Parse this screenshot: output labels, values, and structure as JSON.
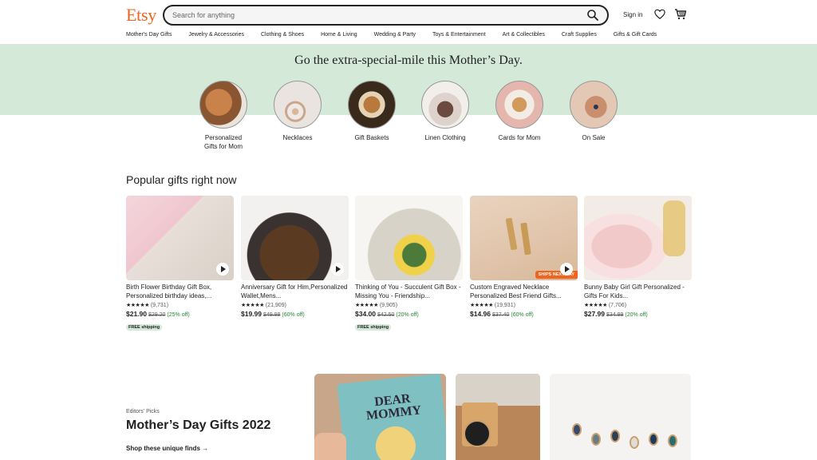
{
  "header": {
    "logo": "Etsy",
    "search_placeholder": "Search for anything",
    "signin": "Sign in"
  },
  "nav": [
    "Mother's Day Gifts",
    "Jewelry & Accessories",
    "Clothing & Shoes",
    "Home & Living",
    "Wedding & Party",
    "Toys & Entertainment",
    "Art & Collectibles",
    "Craft Supplies",
    "Gifts & Gift Cards"
  ],
  "banner": {
    "title": "Go the extra-special-mile this Mother’s Day."
  },
  "categories": [
    {
      "line1": "Personalized",
      "line2": "Gifts for Mom"
    },
    {
      "line1": "Necklaces",
      "line2": ""
    },
    {
      "line1": "Gift Baskets",
      "line2": ""
    },
    {
      "line1": "Linen Clothing",
      "line2": ""
    },
    {
      "line1": "Cards for Mom",
      "line2": ""
    },
    {
      "line1": "On Sale",
      "line2": ""
    }
  ],
  "popular": {
    "title": "Popular gifts right now",
    "items": [
      {
        "title": "Birth Flower Birthday Gift Box, Personalized birthday ideas,...",
        "stars": "★★★★★",
        "reviews": "(9,731)",
        "price": "$21.90",
        "was": "$29.20",
        "off": "(25% off)",
        "shipping": "FREE shipping"
      },
      {
        "title": "Anniversary Gift for Him,Personalized Wallet,Mens...",
        "stars": "★★★★★",
        "reviews": "(21,909)",
        "price": "$19.99",
        "was": "$49.98",
        "off": "(60% off)",
        "shipping": ""
      },
      {
        "title": "Thinking of You - Succulent Gift Box - Missing You - Friendship...",
        "stars": "★★★★★",
        "reviews": "(9,905)",
        "price": "$34.00",
        "was": "$42.50",
        "off": "(20% off)",
        "shipping": "FREE shipping"
      },
      {
        "title": "Custom Engraved Necklace Personalized Best Friend Gifts...",
        "stars": "★★★★★",
        "reviews": "(19,931)",
        "price": "$14.96",
        "was": "$37.40",
        "off": "(60% off)",
        "shipping": "",
        "badge": "SHIPS NEXT DAY"
      },
      {
        "title": "Bunny Baby Girl Gift Personalized - Gifts For Kids...",
        "stars": "★★★★★",
        "reviews": "(7,706)",
        "price": "$27.99",
        "was": "$34.99",
        "off": "(20% off)",
        "shipping": ""
      }
    ]
  },
  "editors": {
    "label": "Editors' Picks",
    "title": "Mother’s Day Gifts 2022",
    "link": "Shop these unique finds →",
    "book_text": "DEAR MOMMY"
  },
  "colors": {
    "brand": "#f1641e",
    "banner": "#d4e9d7",
    "sale": "#258635"
  }
}
